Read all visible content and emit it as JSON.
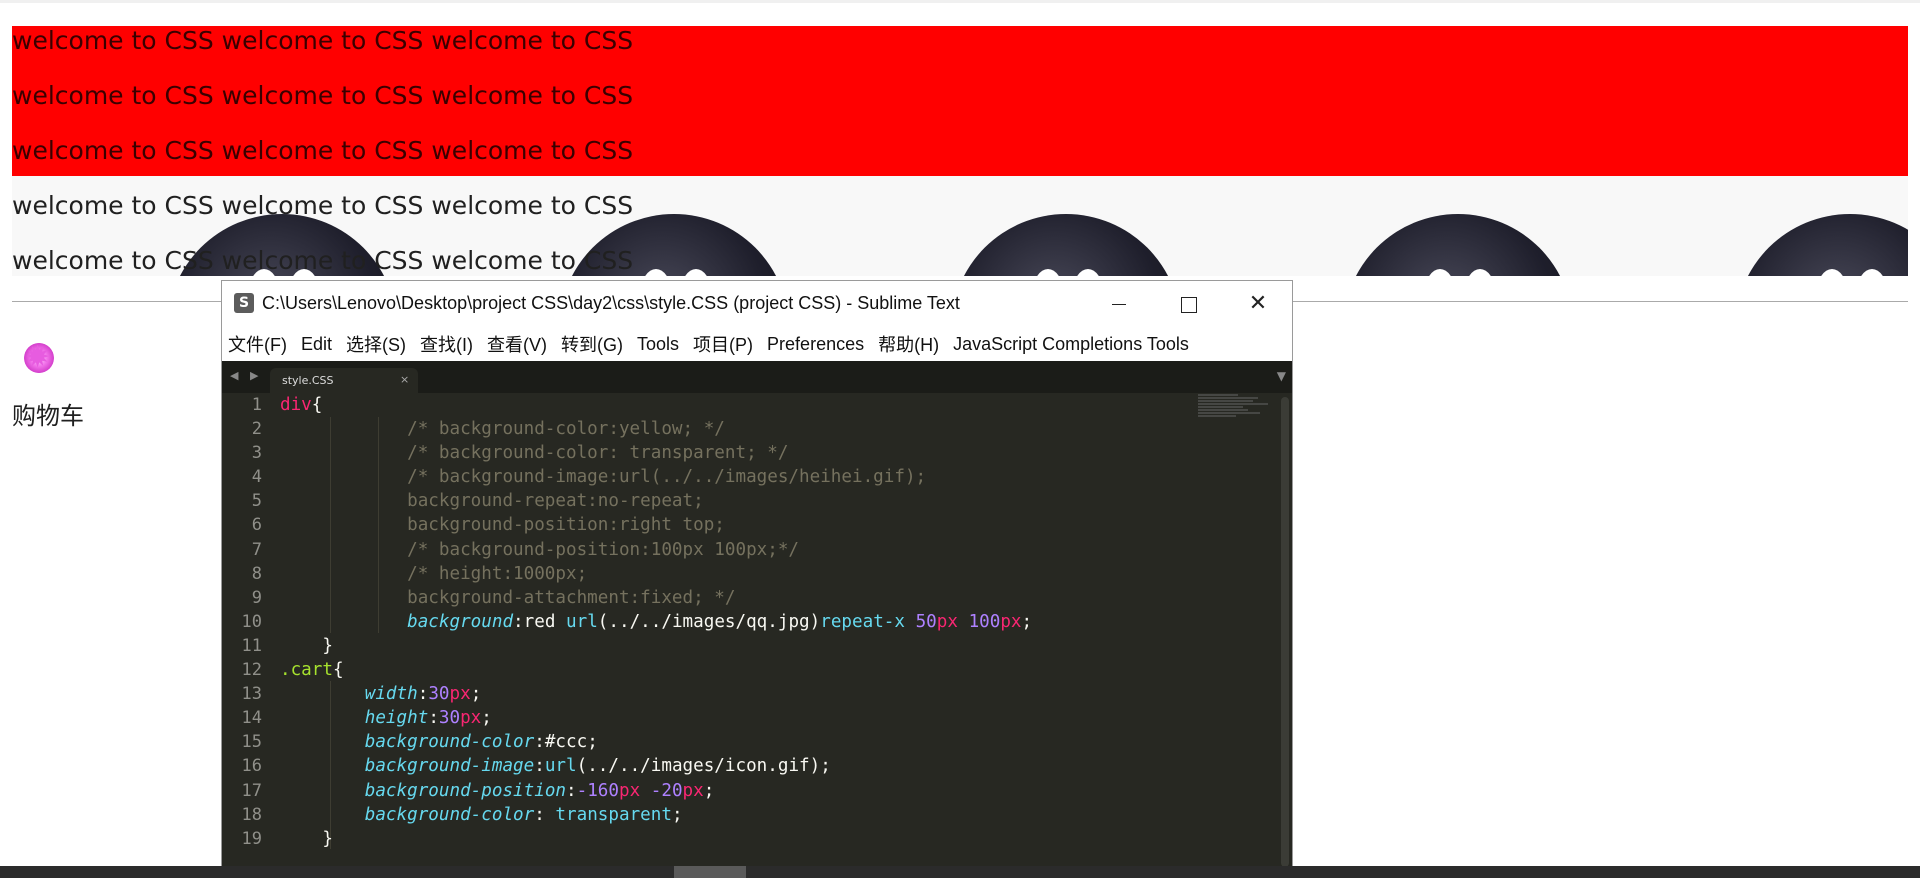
{
  "page": {
    "lines": [
      "welcome to CSS welcome to CSS welcome to CSS",
      "welcome to CSS welcome to CSS welcome to CSS",
      "welcome to CSS welcome to CSS welcome to CSS",
      "welcome to CSS welcome to CSS welcome to CSS",
      "welcome to CSS welcome to CSS welcome to CSS"
    ],
    "cart_label": "购物车",
    "colors": {
      "banner": "#ff0000"
    }
  },
  "sublime": {
    "title": "C:\\Users\\Lenovo\\Desktop\\project CSS\\day2\\css\\style.CSS (project CSS) - Sublime Text",
    "app_icon": "S",
    "menu": [
      "文件(F)",
      "Edit",
      "选择(S)",
      "查找(I)",
      "查看(V)",
      "转到(G)",
      "Tools",
      "项目(P)",
      "Preferences",
      "帮助(H)",
      "JavaScript Completions Tools"
    ],
    "tab_nav": "◀ ▶",
    "tab": {
      "label": "style.CSS",
      "close": "×"
    },
    "tab_dropdown": "▼",
    "line_numbers": [
      "1",
      "2",
      "3",
      "4",
      "5",
      "6",
      "7",
      "8",
      "9",
      "10",
      "11",
      "12",
      "13",
      "14",
      "15",
      "16",
      "17",
      "18",
      "19"
    ],
    "code": [
      [
        [
          "t-tag",
          "div"
        ],
        [
          "t-pl",
          "{"
        ]
      ],
      [
        [
          "t-pl",
          "            "
        ],
        [
          "t-cmt",
          "/* background-color:yellow; */"
        ]
      ],
      [
        [
          "t-pl",
          "            "
        ],
        [
          "t-cmt",
          "/* background-color: transparent; */"
        ]
      ],
      [
        [
          "t-pl",
          "            "
        ],
        [
          "t-cmt",
          "/* background-image:url(../../images/heihei.gif);"
        ]
      ],
      [
        [
          "t-pl",
          "            "
        ],
        [
          "t-cmt",
          "background-repeat:no-repeat;"
        ]
      ],
      [
        [
          "t-pl",
          "            "
        ],
        [
          "t-cmt",
          "background-position:right top;"
        ]
      ],
      [
        [
          "t-pl",
          "            "
        ],
        [
          "t-cmt",
          "/* background-position:100px 100px;*/"
        ]
      ],
      [
        [
          "t-pl",
          "            "
        ],
        [
          "t-cmt",
          "/* height:1000px;"
        ]
      ],
      [
        [
          "t-pl",
          "            "
        ],
        [
          "t-cmt",
          "background-attachment:fixed; */"
        ]
      ],
      [
        [
          "t-pl",
          "            "
        ],
        [
          "t-prop",
          "background"
        ],
        [
          "t-pl",
          ":red "
        ],
        [
          "t-fn",
          "url"
        ],
        [
          "t-pl",
          "(../../images/qq.jpg)"
        ],
        [
          "t-kw",
          "repeat-x "
        ],
        [
          "t-num",
          "50"
        ],
        [
          "t-unit",
          "px "
        ],
        [
          "t-num",
          "100"
        ],
        [
          "t-unit",
          "px"
        ],
        [
          "t-pl",
          ";"
        ]
      ],
      [
        [
          "t-pl",
          "    }"
        ]
      ],
      [
        [
          "t-cls",
          ".cart"
        ],
        [
          "t-pl",
          "{"
        ]
      ],
      [
        [
          "t-pl",
          "        "
        ],
        [
          "t-prop",
          "width"
        ],
        [
          "t-pl",
          ":"
        ],
        [
          "t-num",
          "30"
        ],
        [
          "t-unit",
          "px"
        ],
        [
          "t-pl",
          ";"
        ]
      ],
      [
        [
          "t-pl",
          "        "
        ],
        [
          "t-prop",
          "height"
        ],
        [
          "t-pl",
          ":"
        ],
        [
          "t-num",
          "30"
        ],
        [
          "t-unit",
          "px"
        ],
        [
          "t-pl",
          ";"
        ]
      ],
      [
        [
          "t-pl",
          "        "
        ],
        [
          "t-prop",
          "background-color"
        ],
        [
          "t-pl",
          ":#ccc;"
        ]
      ],
      [
        [
          "t-pl",
          "        "
        ],
        [
          "t-prop",
          "background-image"
        ],
        [
          "t-pl",
          ":"
        ],
        [
          "t-fn",
          "url"
        ],
        [
          "t-pl",
          "(../../images/icon.gif);"
        ]
      ],
      [
        [
          "t-pl",
          "        "
        ],
        [
          "t-prop",
          "background-position"
        ],
        [
          "t-pl",
          ":"
        ],
        [
          "t-num",
          "-160"
        ],
        [
          "t-unit",
          "px "
        ],
        [
          "t-num",
          "-20"
        ],
        [
          "t-unit",
          "px"
        ],
        [
          "t-pl",
          ";"
        ]
      ],
      [
        [
          "t-pl",
          "        "
        ],
        [
          "t-prop",
          "background-color"
        ],
        [
          "t-pl",
          ": "
        ],
        [
          "t-kw",
          "transparent"
        ],
        [
          "t-pl",
          ";"
        ]
      ],
      [
        [
          "t-pl",
          "    }"
        ]
      ]
    ]
  }
}
